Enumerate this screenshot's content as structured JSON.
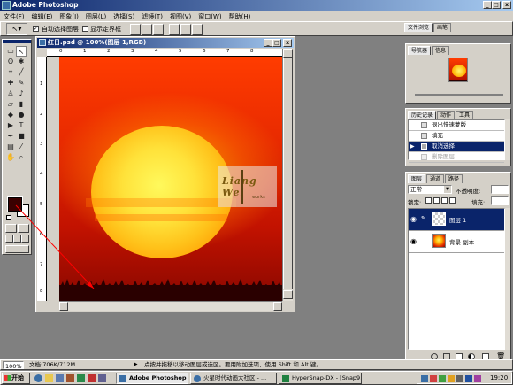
{
  "app": {
    "title": "Adobe Photoshop"
  },
  "menu": [
    "文件(F)",
    "编辑(E)",
    "图象(I)",
    "图层(L)",
    "选择(S)",
    "滤镜(T)",
    "视图(V)",
    "窗口(W)",
    "帮助(H)"
  ],
  "options_bar": {
    "auto_select": "自动选择图层",
    "show_bounds": "显示定界框",
    "browser_tab": "文件浏览",
    "brushes_tab": "画笔"
  },
  "document": {
    "title": "红日.psd @ 100%(图层 1,RGB)"
  },
  "watermark": {
    "line1": "Liang Wei",
    "line2": "works"
  },
  "ruler": {
    "h": [
      "0",
      "1",
      "2",
      "3",
      "4",
      "5",
      "6",
      "7",
      "8"
    ],
    "v": [
      "1",
      "2",
      "3",
      "4",
      "5",
      "6",
      "7",
      "8"
    ]
  },
  "navigator": {
    "tabs": [
      "导航器",
      "信息"
    ]
  },
  "history": {
    "tabs": [
      "历史记录",
      "动作",
      "工具"
    ],
    "items": [
      {
        "label": "退出快速蒙版",
        "state": "normal"
      },
      {
        "label": "填充",
        "state": "normal"
      },
      {
        "label": "取消选择",
        "state": "selected"
      },
      {
        "label": "删除图层",
        "state": "dimmed"
      }
    ]
  },
  "layers": {
    "tabs": [
      "图层",
      "通道",
      "路径"
    ],
    "blend_mode": "正常",
    "opacity_label": "不透明度:",
    "lock_label": "锁定:",
    "fill_label": "填充:",
    "items": [
      {
        "name": "图层 1",
        "selected": true
      },
      {
        "name": "背景 副本",
        "selected": false
      }
    ]
  },
  "status_bar": {
    "zoom": "100%",
    "doc_info": "文档:706K/712M",
    "hint": "点按并拖移以移动图层或选区。要用附加选项，使用 Shift 和 Alt 键。"
  },
  "taskbar": {
    "start": "开始",
    "items": [
      "Adobe Photoshop",
      "火星时代动画大社区 - ...",
      "HyperSnap-DX - [Snap9.j..."
    ],
    "clock": "19:20"
  },
  "colors": {
    "foreground": "#3a0000",
    "background": "#ffffff",
    "titlebar": "#0a246a",
    "annotation_arrow": "#ff0000"
  },
  "icons": [
    "move-tool-icon",
    "marquee-tool-icon",
    "lasso-tool-icon",
    "magic-wand-icon",
    "crop-icon",
    "brush-icon",
    "eraser-icon",
    "text-tool-icon",
    "hand-icon",
    "zoom-icon",
    "eye-icon",
    "trash-icon",
    "start-flag-icon"
  ]
}
